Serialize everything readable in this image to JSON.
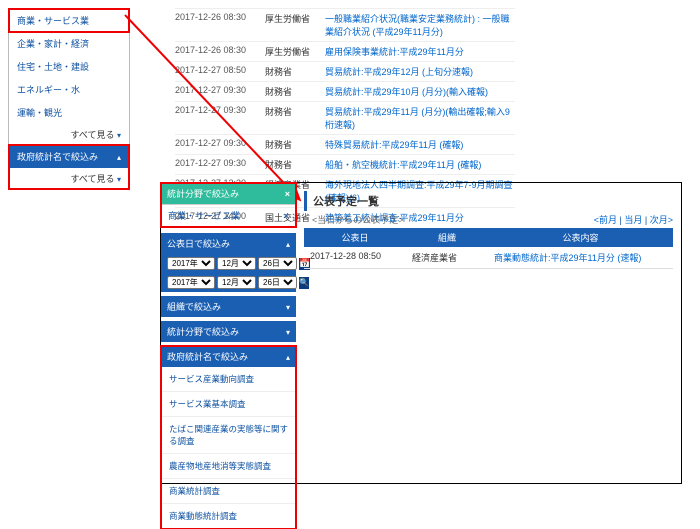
{
  "p1": {
    "items": [
      "商業・サービス業",
      "企業・家計・経済",
      "住宅・土地・建設",
      "エネルギー・水",
      "運輸・観光"
    ],
    "more": "すべて見る",
    "hdr": "政府統計名で絞込み"
  },
  "t1": [
    {
      "d": "2017-12-26 08:30",
      "m": "厚生労働省",
      "t": "一般職業紹介状況(職業安定業務統計) : 一般職業紹介状況 (平成29年11月分)"
    },
    {
      "d": "2017-12-26 08:30",
      "m": "厚生労働省",
      "t": "雇用保険事業統計:平成29年11月分"
    },
    {
      "d": "2017-12-27 08:50",
      "m": "財務省",
      "t": "貿易統計:平成29年12月 (上旬分速報)"
    },
    {
      "d": "2017-12-27 09:30",
      "m": "財務省",
      "t": "貿易統計:平成29年10月 (月分)(輸入確報)"
    },
    {
      "d": "2017-12-27 09:30",
      "m": "財務省",
      "t": "貿易統計:平成29年11月 (月分)(輸出確報;輸入9桁速報)"
    },
    {
      "d": "2017-12-27 09:30",
      "m": "財務省",
      "t": "特殊貿易統計:平成29年11月 (確報)"
    },
    {
      "d": "2017-12-27 09:30",
      "m": "財務省",
      "t": "船舶・航空機統計:平成29年11月 (確報)"
    },
    {
      "d": "2017-12-27 13:30",
      "m": "経済産業省",
      "t": "海外現地法人四半期調査:平成29年7-9月期調査(確報)(6)"
    },
    {
      "d": "2017-12-27 14:00",
      "m": "国土交通省",
      "t": "建築着工統計調査:平成29年11月分"
    }
  ],
  "p2": {
    "tag1": "統計分野で絞込み",
    "tag2": "商業・サービス業",
    "hdr2": "公表日で絞込み",
    "sel": {
      "y1": "2017年",
      "m1": "12月",
      "d1": "26日",
      "y2": "2017年",
      "m2": "12月",
      "d2": "26日"
    },
    "hdr3": "組織で絞込み",
    "hdr4": "統計分野で絞込み",
    "hdr5": "政府統計名で絞込み",
    "subs": [
      "サービス産業動向調査",
      "サービス業基本調査",
      "たばこ関連産業の実態等に関する調査",
      "農産物地産地消等実態調査",
      "商業統計調査",
      "商業動態統計調査"
    ],
    "title": "公表予定一覧",
    "subtitle": "<当日からの公表予定>",
    "nav": [
      "<前月",
      "当月",
      "次月>"
    ],
    "th": [
      "公表日",
      "組織",
      "公表内容"
    ],
    "row": {
      "d": "2017-12-28 08:50",
      "m": "経済産業省",
      "t": "商業動態統計:平成29年11月分 (速報)"
    }
  }
}
